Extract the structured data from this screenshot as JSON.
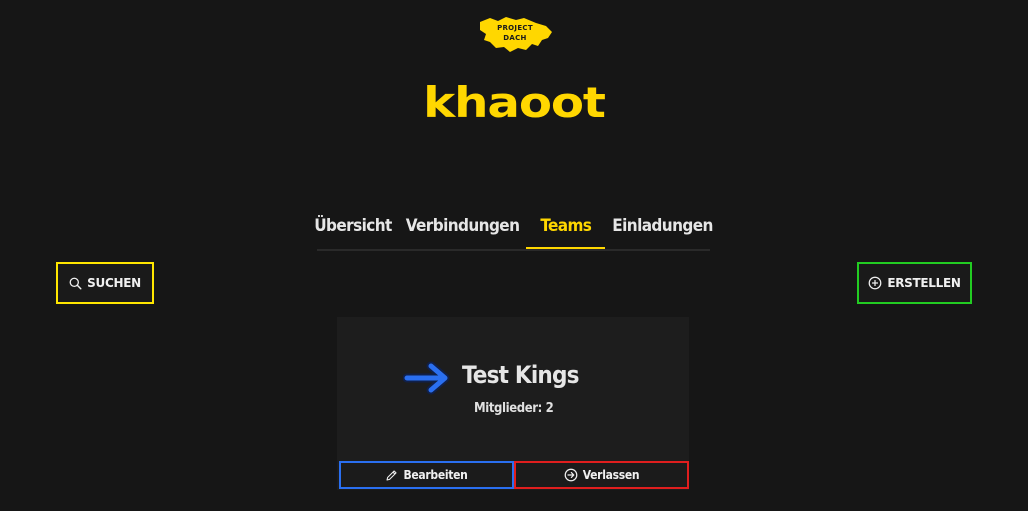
{
  "header": {
    "logo": {
      "line1": "PROJECT",
      "line2": "DACH",
      "icon": "project-dach-logo"
    },
    "title": "khaoot"
  },
  "tabs": [
    {
      "label": "Übersicht",
      "active": false
    },
    {
      "label": "Verbindungen",
      "active": false
    },
    {
      "label": "Teams",
      "active": true
    },
    {
      "label": "Einladungen",
      "active": false
    }
  ],
  "actions": {
    "search_label": "SUCHEN",
    "search_icon": "search-icon",
    "create_label": "ERSTELLEN",
    "create_icon": "plus-circle-icon"
  },
  "team_card": {
    "name": "Test Kings",
    "members": "Mitglieder: 2",
    "edit_label": "Bearbeiten",
    "leave_label": "Verlassen"
  },
  "colors": {
    "background": "#161616",
    "accent": "#ffd700",
    "search_border": "#ffe600",
    "create_border": "#22cc22",
    "edit_border": "#2a6ff0",
    "leave_border": "#e01e1e",
    "arrow": "#2a6ff0"
  }
}
